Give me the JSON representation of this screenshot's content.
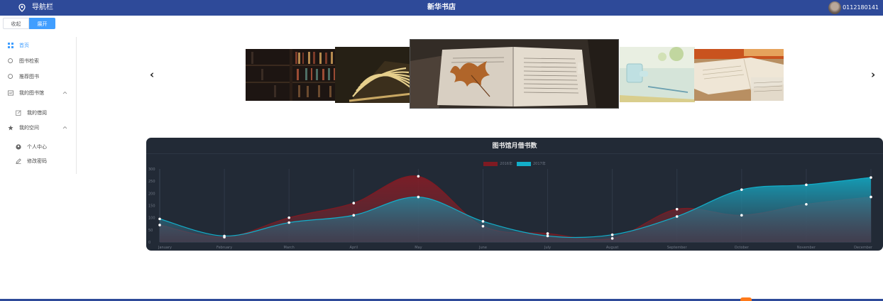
{
  "header": {
    "nav_label": "导航栏",
    "app_title": "新华书店",
    "user_id": "0112180141"
  },
  "toggle": {
    "collapse_label": "收起",
    "expand_label": "展开"
  },
  "sidebar": {
    "items": [
      {
        "label": "首页",
        "icon": "grid-icon",
        "active": true
      },
      {
        "label": "图书检索",
        "icon": "search-icon"
      },
      {
        "label": "推荐图书",
        "icon": "search-icon"
      },
      {
        "label": "我的图书馆",
        "icon": "library-icon",
        "expandable": true
      },
      {
        "label": "我的借阅",
        "icon": "edit-icon",
        "sub": true
      },
      {
        "label": "我的空间",
        "icon": "star-icon",
        "expandable": true
      },
      {
        "label": "个人中心",
        "icon": "user-icon",
        "sub": true
      },
      {
        "label": "修改密码",
        "icon": "pen-icon",
        "sub": true
      }
    ]
  },
  "carousel": {
    "prev_icon": "chevron-left-icon",
    "next_icon": "chevron-right-icon",
    "slides": [
      "bookshelf-photo",
      "open-book-pages-photo",
      "open-book-leaf-photo",
      "desk-glass-photo",
      "book-on-table-photo"
    ]
  },
  "chart_data": {
    "type": "area",
    "title": "图书馆月借书数",
    "categories": [
      "January",
      "February",
      "March",
      "April",
      "May",
      "June",
      "July",
      "August",
      "September",
      "October",
      "November",
      "December"
    ],
    "series": [
      {
        "name": "2016年",
        "color": "#7f1a22",
        "values": [
          70,
          20,
          100,
          160,
          270,
          65,
          35,
          15,
          135,
          110,
          155,
          185
        ]
      },
      {
        "name": "2017年",
        "color": "#12aec9",
        "values": [
          95,
          25,
          80,
          110,
          185,
          85,
          25,
          30,
          105,
          215,
          235,
          265
        ]
      }
    ],
    "y_ticks": [
      "300",
      "250",
      "200",
      "150",
      "100",
      "50",
      "0"
    ],
    "ylim": [
      0,
      300
    ],
    "grid": "vertical"
  }
}
